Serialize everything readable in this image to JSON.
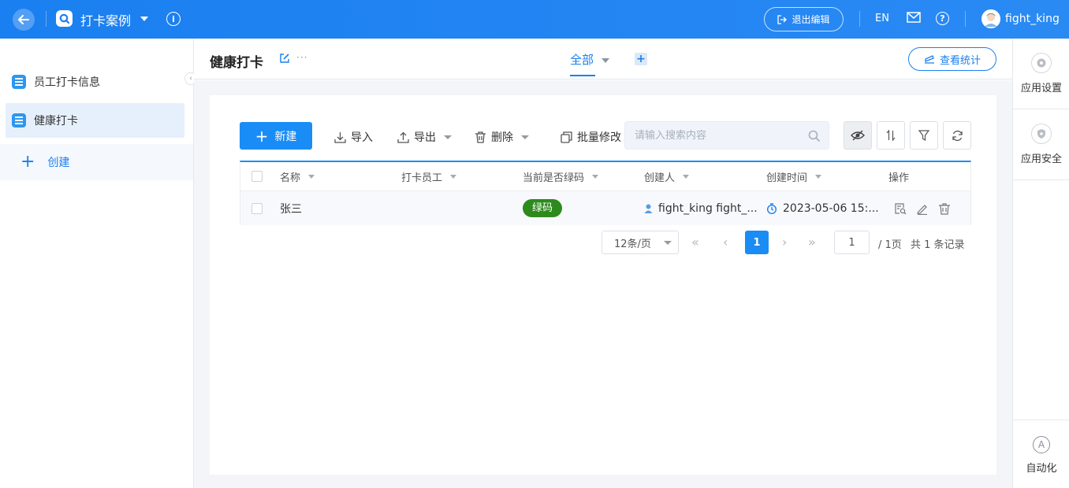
{
  "topbar": {
    "app_title": "打卡案例",
    "exit_label": "退出编辑",
    "lang": "EN",
    "username": "fight_king"
  },
  "sidebar": {
    "items": [
      {
        "label": "员工打卡信息"
      },
      {
        "label": "健康打卡"
      }
    ],
    "create_label": "创建"
  },
  "header": {
    "title": "健康打卡",
    "more": "···",
    "view_tab": "全部",
    "add_view": "+",
    "stats_label": "查看统计"
  },
  "right_rail": {
    "app_settings": "应用设置",
    "app_security": "应用安全",
    "automation": "自动化"
  },
  "toolbar": {
    "new_label": "新建",
    "import_label": "导入",
    "export_label": "导出",
    "delete_label": "删除",
    "batch_edit_label": "批量修改",
    "search_placeholder": "请输入搜索内容"
  },
  "table": {
    "columns": [
      "名称",
      "打卡员工",
      "当前是否绿码",
      "创建人",
      "创建时间",
      "操作"
    ],
    "rows": [
      {
        "name": "张三",
        "employee": "",
        "green_code": "绿码",
        "creator": "fight_king fight_...",
        "created_at": "2023-05-06 15:..."
      }
    ]
  },
  "pagination": {
    "page_size": "12条/页",
    "current_page": "1",
    "jump_value": "1",
    "total_pages": "/ 1页",
    "total_records": "共 1 条记录"
  },
  "colors": {
    "primary": "#1a8cf5",
    "topbar": "#1a7ff0",
    "green_tag": "#2d8a1d"
  }
}
